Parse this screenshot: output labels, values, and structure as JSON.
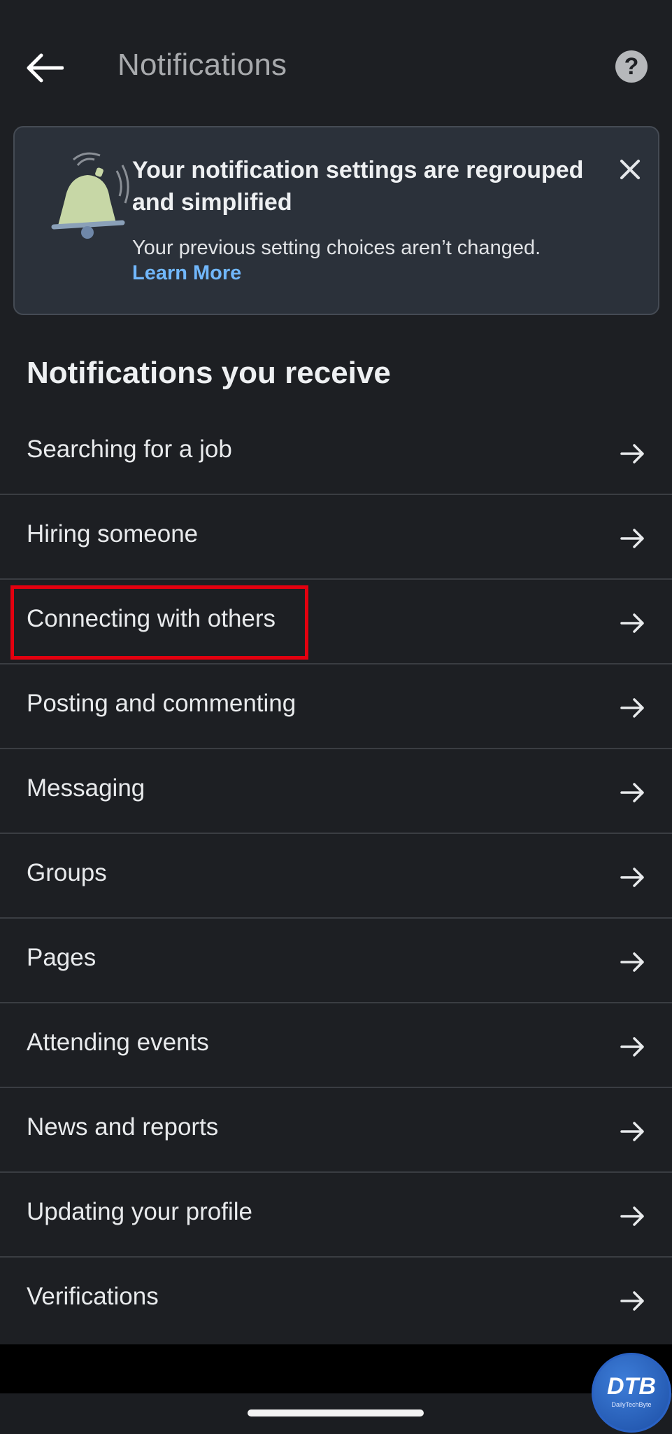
{
  "header": {
    "title": "Notifications",
    "back_icon": "arrow-left-icon",
    "help_label": "?"
  },
  "banner": {
    "icon": "bell-icon",
    "title": "Your notification settings are regrouped and simplified",
    "text": "Your previous setting choices aren’t changed.",
    "link": "Learn More",
    "close_icon": "close-icon",
    "colors": {
      "background": "#2b313a",
      "link": "#71b7fb",
      "bell": "#c7d7a6"
    }
  },
  "section": {
    "title": "Notifications you receive"
  },
  "items": [
    {
      "label": "Searching for a job"
    },
    {
      "label": "Hiring someone"
    },
    {
      "label": "Connecting with others"
    },
    {
      "label": "Posting and commenting"
    },
    {
      "label": "Messaging"
    },
    {
      "label": "Groups"
    },
    {
      "label": "Pages"
    },
    {
      "label": "Attending events"
    },
    {
      "label": "News and reports"
    },
    {
      "label": "Updating your profile"
    },
    {
      "label": "Verifications"
    }
  ],
  "highlight": {
    "target": "Connecting with others",
    "color": "#e4000f"
  },
  "watermark": {
    "text": "DTB",
    "subtext": "DailyTechByte"
  }
}
